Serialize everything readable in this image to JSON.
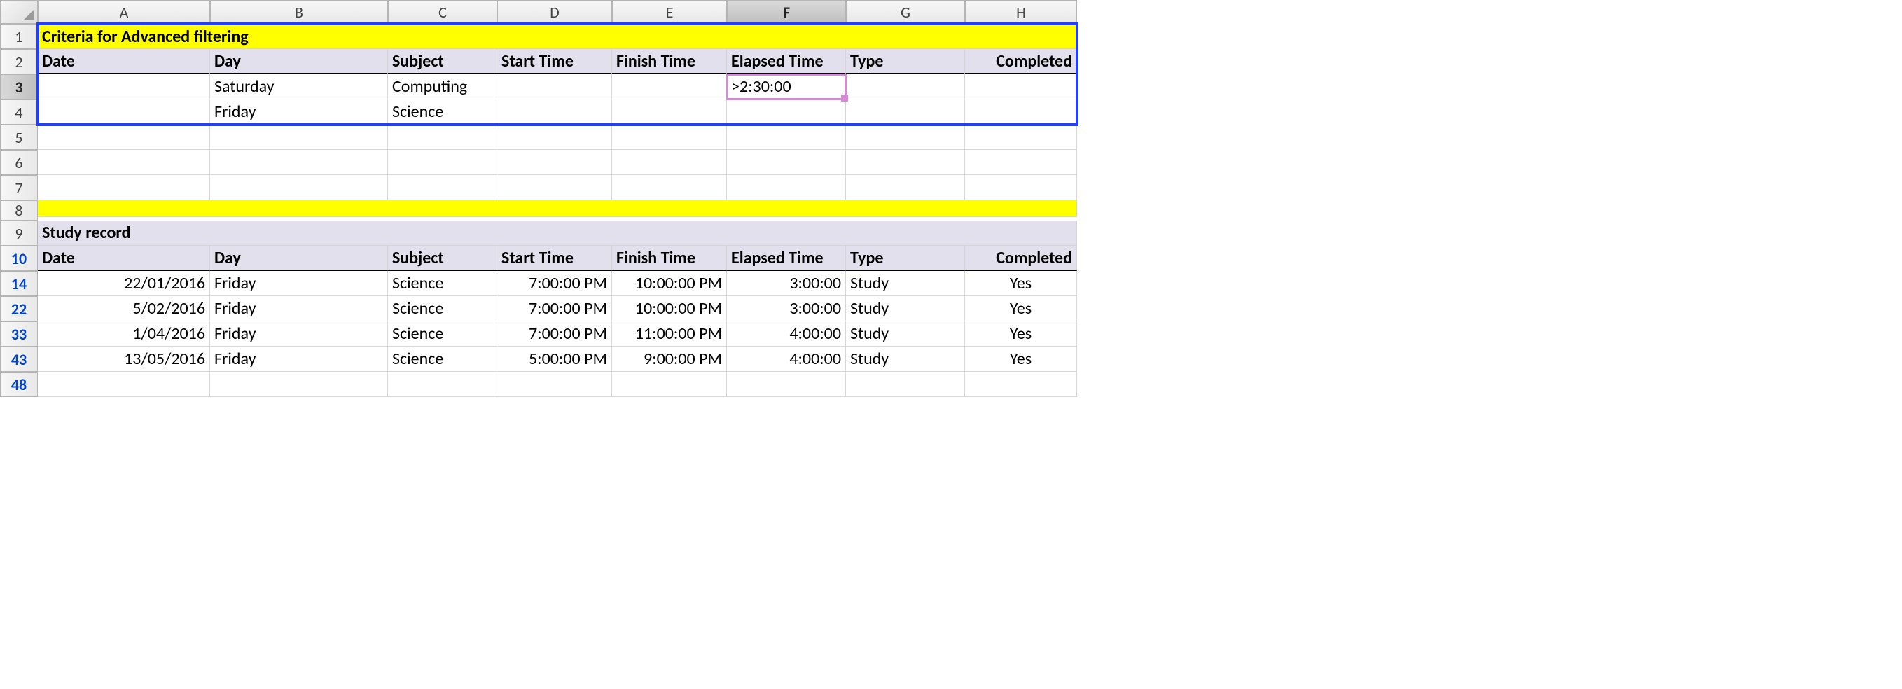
{
  "columns": [
    "A",
    "B",
    "C",
    "D",
    "E",
    "F",
    "G",
    "H"
  ],
  "rows": [
    "1",
    "2",
    "3",
    "4",
    "5",
    "6",
    "7",
    "8",
    "9",
    "10",
    "14",
    "22",
    "33",
    "43",
    "48"
  ],
  "filtered_rows": [
    "10",
    "14",
    "22",
    "33",
    "43",
    "48"
  ],
  "selected_row": "3",
  "selected_col": "F",
  "active_cell": {
    "value": ">2:30:00"
  },
  "colors": {
    "highlight": "#ffff00",
    "header_fill": "#e1e0ec",
    "selection": "#d689d6",
    "criteria_outline": "#203fff"
  },
  "criteria": {
    "title": "Criteria for Advanced filtering",
    "headers": [
      "Date",
      "Day",
      "Subject",
      "Start Time",
      "Finish Time",
      "Elapsed Time",
      "Type",
      "Completed"
    ],
    "rows": [
      {
        "Date": "",
        "Day": "Saturday",
        "Subject": "Computing",
        "Start Time": "",
        "Finish Time": "",
        "Elapsed Time": ">2:30:00",
        "Type": "",
        "Completed": ""
      },
      {
        "Date": "",
        "Day": "Friday",
        "Subject": "Science",
        "Start Time": "",
        "Finish Time": "",
        "Elapsed Time": "",
        "Type": "",
        "Completed": ""
      }
    ]
  },
  "record": {
    "title": "Study record",
    "headers": [
      "Date",
      "Day",
      "Subject",
      "Start Time",
      "Finish Time",
      "Elapsed Time",
      "Type",
      "Completed"
    ],
    "rows": [
      {
        "Date": "22/01/2016",
        "Day": "Friday",
        "Subject": "Science",
        "Start Time": "7:00:00 PM",
        "Finish Time": "10:00:00 PM",
        "Elapsed Time": "3:00:00",
        "Type": "Study",
        "Completed": "Yes"
      },
      {
        "Date": "5/02/2016",
        "Day": "Friday",
        "Subject": "Science",
        "Start Time": "7:00:00 PM",
        "Finish Time": "10:00:00 PM",
        "Elapsed Time": "3:00:00",
        "Type": "Study",
        "Completed": "Yes"
      },
      {
        "Date": "1/04/2016",
        "Day": "Friday",
        "Subject": "Science",
        "Start Time": "7:00:00 PM",
        "Finish Time": "11:00:00 PM",
        "Elapsed Time": "4:00:00",
        "Type": "Study",
        "Completed": "Yes"
      },
      {
        "Date": "13/05/2016",
        "Day": "Friday",
        "Subject": "Science",
        "Start Time": "5:00:00 PM",
        "Finish Time": "9:00:00 PM",
        "Elapsed Time": "4:00:00",
        "Type": "Study",
        "Completed": "Yes"
      }
    ]
  }
}
